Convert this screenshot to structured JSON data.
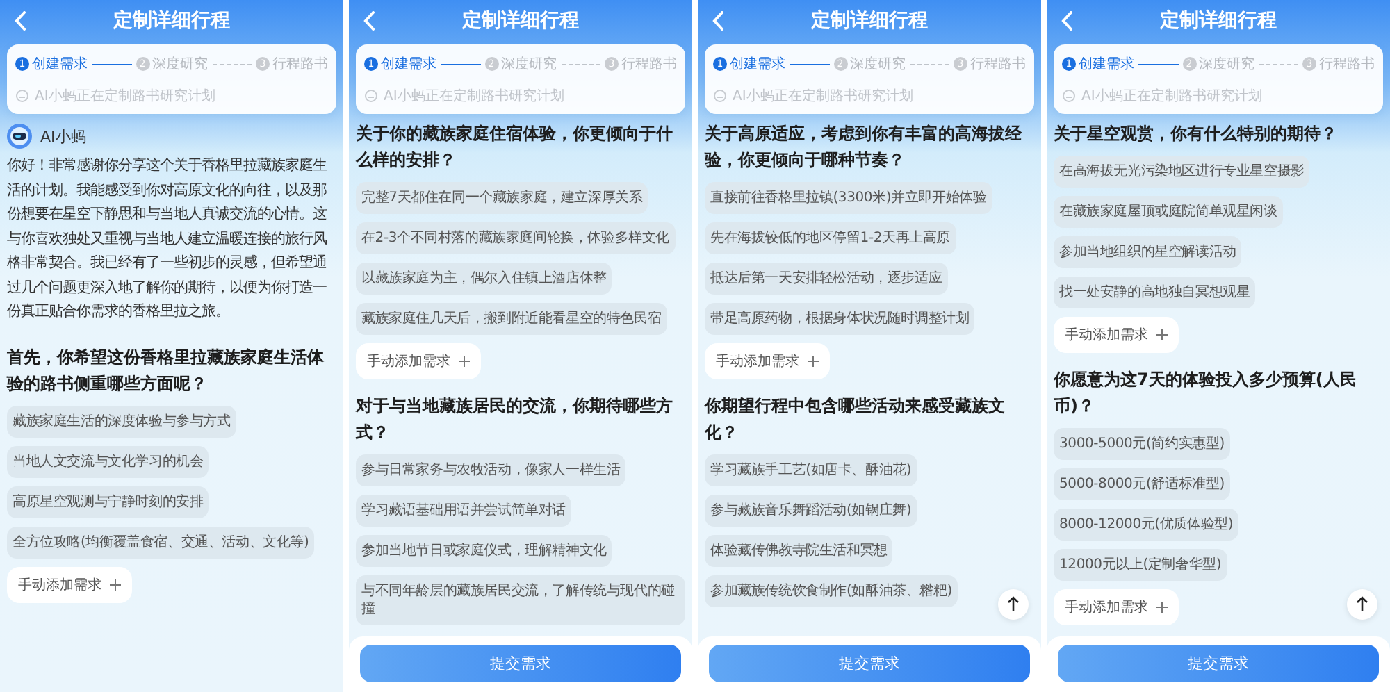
{
  "panels": [
    {
      "title": "定制详细行程",
      "steps": [
        {
          "number": "1",
          "label": "创建需求",
          "selected": true
        },
        {
          "number": "2",
          "label": "深度研究",
          "selected": false
        },
        {
          "number": "3",
          "label": "行程路书",
          "selected": false
        }
      ],
      "status": "AI小蚂正在定制路书研究计划",
      "assistant": {
        "name": "AI小蚂",
        "message": "你好！非常感谢你分享这个关于香格里拉藏族家庭生活的计划。我能感受到你对高原文化的向往，以及那份想要在星空下静思和与当地人真诚交流的心情。这与你喜欢独处又重视与当地人建立温暖连接的旅行风格非常契合。我已经有了一些初步的灵感，但希望通过几个问题更深入地了解你的期待，以便为你打造一份真正贴合你需求的香格里拉之旅。"
      },
      "questions": [
        {
          "text": "首先，你希望这份香格里拉藏族家庭生活体验的路书侧重哪些方面呢？",
          "options": [
            "藏族家庭生活的深度体验与参与方式",
            "当地人文交流与文化学习的机会",
            "高原星空观测与宁静时刻的安排",
            "全方位攻略(均衡覆盖食宿、交通、活动、文化等)"
          ],
          "add_label": "手动添加需求"
        }
      ]
    },
    {
      "title": "定制详细行程",
      "steps": [
        {
          "number": "1",
          "label": "创建需求",
          "selected": true
        },
        {
          "number": "2",
          "label": "深度研究",
          "selected": false
        },
        {
          "number": "3",
          "label": "行程路书",
          "selected": false
        }
      ],
      "status": "AI小蚂正在定制路书研究计划",
      "questions": [
        {
          "text": "关于你的藏族家庭住宿体验，你更倾向于什么样的安排？",
          "options": [
            "完整7天都住在同一个藏族家庭，建立深厚关系",
            "在2-3个不同村落的藏族家庭间轮换，体验多样文化",
            "以藏族家庭为主，偶尔入住镇上酒店休整",
            "藏族家庭住几天后，搬到附近能看星空的特色民宿"
          ],
          "add_label": "手动添加需求"
        },
        {
          "text": "对于与当地藏族居民的交流，你期待哪些方式？",
          "options": [
            "参与日常家务与农牧活动，像家人一样生活",
            "学习藏语基础用语并尝试简单对话",
            "参加当地节日或家庭仪式，理解精神文化",
            "与不同年龄层的藏族居民交流，了解传统与现代的碰撞"
          ]
        }
      ],
      "submit": "提交需求"
    },
    {
      "title": "定制详细行程",
      "steps": [
        {
          "number": "1",
          "label": "创建需求",
          "selected": true
        },
        {
          "number": "2",
          "label": "深度研究",
          "selected": false
        },
        {
          "number": "3",
          "label": "行程路书",
          "selected": false
        }
      ],
      "status": "AI小蚂正在定制路书研究计划",
      "questions": [
        {
          "text": "关于高原适应，考虑到你有丰富的高海拔经验，你更倾向于哪种节奏？",
          "options": [
            "直接前往香格里拉镇(3300米)并立即开始体验",
            "先在海拔较低的地区停留1-2天再上高原",
            "抵达后第一天安排轻松活动，逐步适应",
            "带足高原药物，根据身体状况随时调整计划"
          ],
          "add_label": "手动添加需求"
        },
        {
          "text": "你期望行程中包含哪些活动来感受藏族文化？",
          "options": [
            "学习藏族手工艺(如唐卡、酥油花)",
            "参与藏族音乐舞蹈活动(如锅庄舞)",
            "体验藏传佛教寺院生活和冥想",
            "参加藏族传统饮食制作(如酥油茶、糌粑)"
          ]
        }
      ],
      "scroll_top": true,
      "submit": "提交需求"
    },
    {
      "title": "定制详细行程",
      "steps": [
        {
          "number": "1",
          "label": "创建需求",
          "selected": true
        },
        {
          "number": "2",
          "label": "深度研究",
          "selected": false
        },
        {
          "number": "3",
          "label": "行程路书",
          "selected": false
        }
      ],
      "status": "AI小蚂正在定制路书研究计划",
      "questions": [
        {
          "text": "关于星空观赏，你有什么特别的期待？",
          "options": [
            "在高海拔无光污染地区进行专业星空摄影",
            "在藏族家庭屋顶或庭院简单观星闲谈",
            "参加当地组织的星空解读活动",
            "找一处安静的高地独自冥想观星"
          ],
          "add_label": "手动添加需求"
        },
        {
          "text": "你愿意为这7天的体验投入多少预算(人民币)？",
          "options": [
            "3000-5000元(简约实惠型)",
            "5000-8000元(舒适标准型)",
            "8000-12000元(优质体验型)",
            "12000元以上(定制奢华型)"
          ],
          "add_label": "手动添加需求"
        }
      ],
      "scroll_top": true,
      "submit": "提交需求"
    }
  ]
}
